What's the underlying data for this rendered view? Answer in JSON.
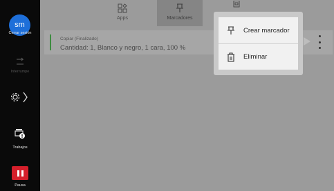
{
  "sidebar": {
    "avatar_initials": "sm",
    "logout_label": "Cerrar sesión",
    "interrupt_label": "Interrumpe",
    "jobs_label": "Trabajos",
    "pause_label": "Pausa"
  },
  "tabs": [
    {
      "label": "Apps",
      "icon": "apps-icon"
    },
    {
      "label": "Marcadores",
      "icon": "bookmark-pin-icon",
      "active": true
    },
    {
      "label": "",
      "icon": "document-icon"
    }
  ],
  "job": {
    "title": "Copiar (Finalizado)",
    "detail": "Cantidad: 1, Blanco y negro, 1 cara, 100 %"
  },
  "menu": {
    "create_bookmark": "Crear marcador",
    "delete": "Eliminar"
  },
  "colors": {
    "sidebar_bg": "#0a0a0a",
    "avatar": "#1e6fd9",
    "pause": "#d51f2b",
    "job_status_bar": "#3d8b40"
  }
}
